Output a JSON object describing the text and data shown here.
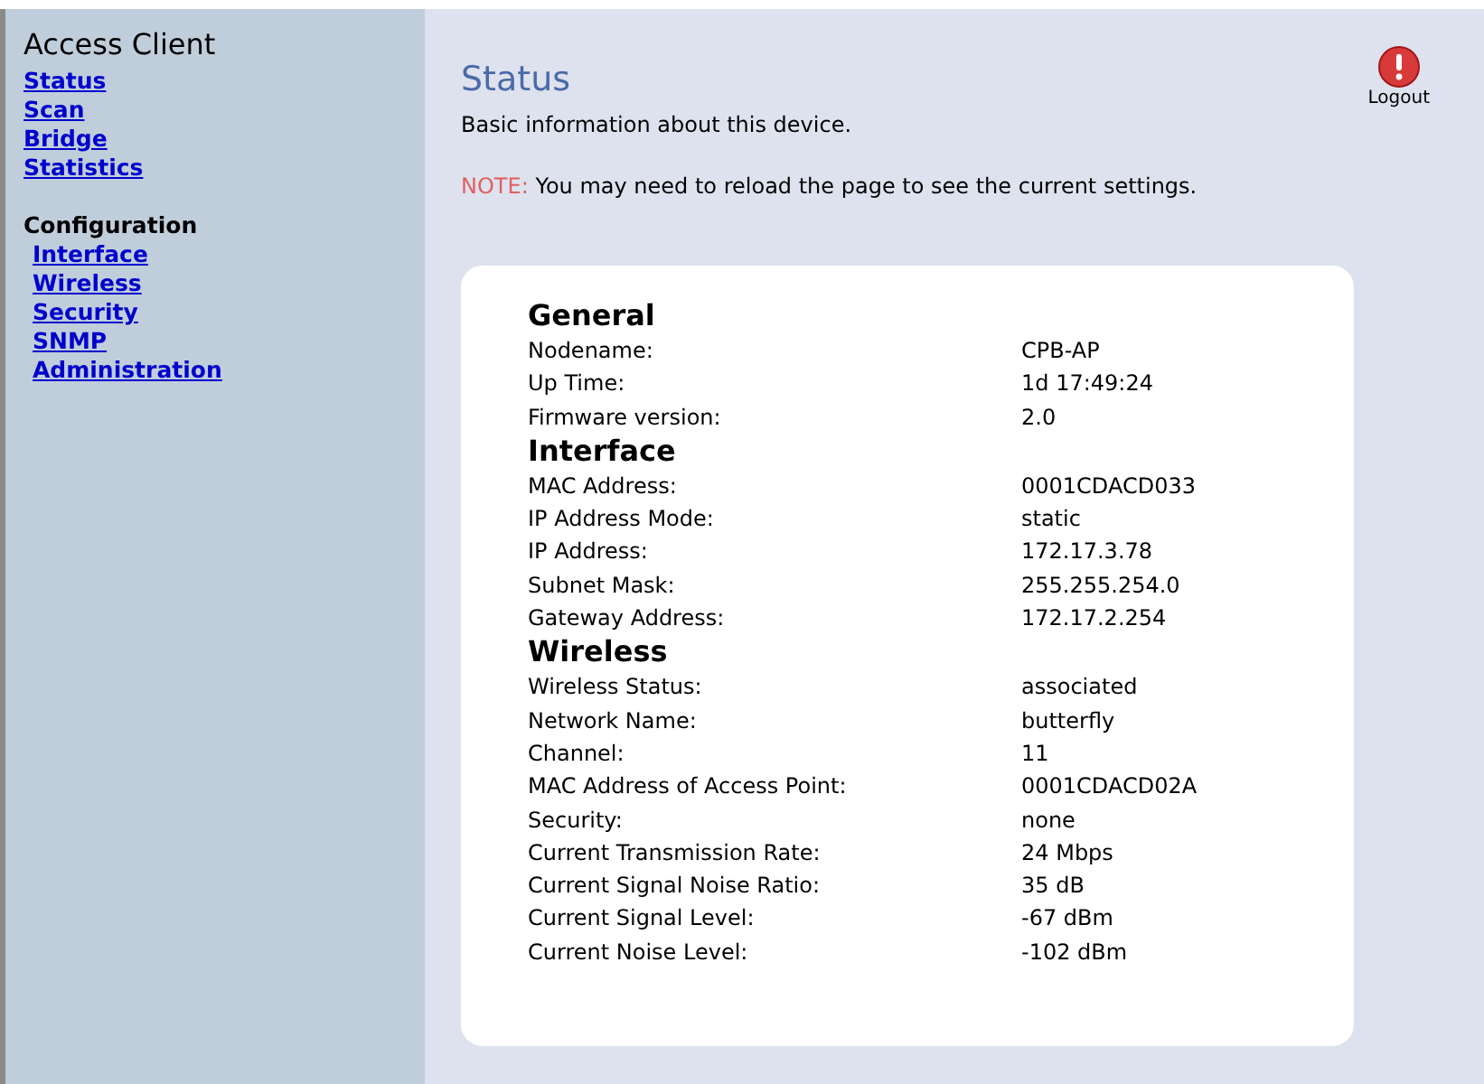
{
  "sidebar": {
    "title": "Access Client",
    "links": [
      {
        "label": "Status"
      },
      {
        "label": "Scan"
      },
      {
        "label": "Bridge"
      },
      {
        "label": "Statistics"
      }
    ],
    "section": "Configuration",
    "config_links": [
      {
        "label": "Interface"
      },
      {
        "label": "Wireless"
      },
      {
        "label": "Security"
      },
      {
        "label": "SNMP"
      },
      {
        "label": "Administration"
      }
    ]
  },
  "header": {
    "title": "Status",
    "logout": "Logout",
    "description": "Basic information about this device.",
    "note_label": "NOTE:",
    "note": "You may need to reload the page to see the current settings."
  },
  "sections": [
    {
      "title": "General",
      "rows": [
        {
          "label": "Nodename:",
          "value": "CPB-AP"
        },
        {
          "label": "Up Time:",
          "value": "1d 17:49:24"
        },
        {
          "label": "Firmware version:",
          "value": "2.0"
        }
      ]
    },
    {
      "title": "Interface",
      "rows": [
        {
          "label": "MAC Address:",
          "value": "0001CDACD033"
        },
        {
          "label": "IP Address Mode:",
          "value": "static"
        },
        {
          "label": "IP Address:",
          "value": "172.17.3.78"
        },
        {
          "label": "Subnet Mask:",
          "value": "255.255.254.0"
        },
        {
          "label": "Gateway Address:",
          "value": "172.17.2.254"
        }
      ]
    },
    {
      "title": "Wireless",
      "rows": [
        {
          "label": "Wireless Status:",
          "value": "associated"
        },
        {
          "label": "Network Name:",
          "value": "butterfly"
        },
        {
          "label": "Channel:",
          "value": "11"
        },
        {
          "label": "MAC Address of Access Point:",
          "value": "0001CDACD02A"
        },
        {
          "label": "Security:",
          "value": "none"
        },
        {
          "label": "Current Transmission Rate:",
          "value": "24 Mbps"
        },
        {
          "label": "Current Signal Noise Ratio:",
          "value": "35 dB"
        },
        {
          "label": "Current Signal Level:",
          "value": "-67 dBm"
        },
        {
          "label": "Current Noise Level:",
          "value": "-102 dBm"
        }
      ]
    }
  ]
}
